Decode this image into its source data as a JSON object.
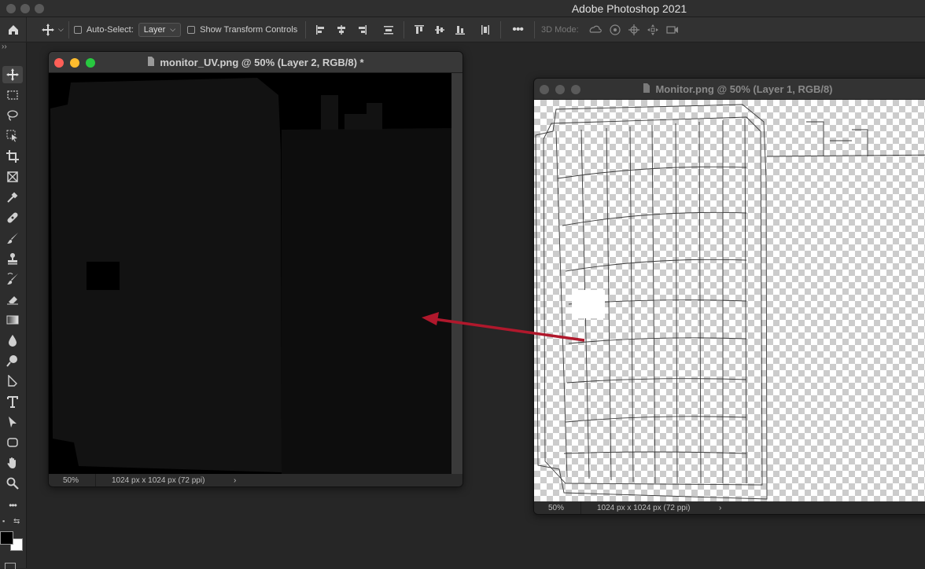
{
  "app": {
    "title": "Adobe Photoshop 2021"
  },
  "options_bar": {
    "auto_select_label": "Auto-Select:",
    "auto_select_value": "Layer",
    "show_transform_label": "Show Transform Controls",
    "mode_3d_label": "3D Mode:"
  },
  "documents": [
    {
      "title": "monitor_UV.png @ 50% (Layer 2, RGB/8) *",
      "zoom": "50%",
      "info": "1024 px x 1024 px (72 ppi)"
    },
    {
      "title": "Monitor.png @ 50% (Layer 1, RGB/8)",
      "zoom": "50%",
      "info": "1024 px x 1024 px (72 ppi)"
    }
  ],
  "colors": {
    "arrow": "#b0182c",
    "close": "#ff5f57",
    "minimize": "#febc2e",
    "maximize": "#28c840"
  }
}
